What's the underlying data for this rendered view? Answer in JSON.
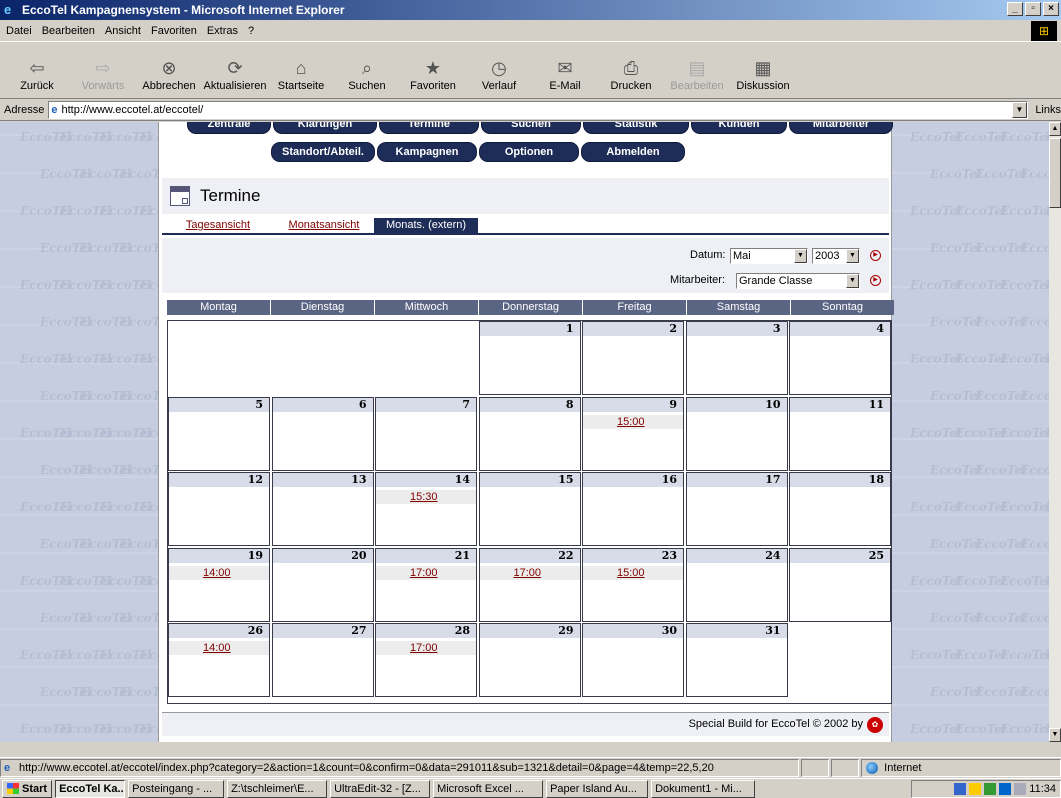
{
  "window": {
    "title": "EccoTel Kampagnensystem - Microsoft Internet Explorer",
    "controls": [
      "_",
      "▫",
      "×"
    ]
  },
  "menu": [
    "Datei",
    "Bearbeiten",
    "Ansicht",
    "Favoriten",
    "Extras",
    "?"
  ],
  "toolbar": [
    {
      "label": "Zurück",
      "icon": "⇦",
      "name": "back-button",
      "disabled": false
    },
    {
      "label": "Vorwärts",
      "icon": "⇨",
      "name": "forward-button",
      "disabled": true
    },
    {
      "label": "Abbrechen",
      "icon": "⊗",
      "name": "stop-button",
      "disabled": false
    },
    {
      "label": "Aktualisieren",
      "icon": "⟳",
      "name": "refresh-button",
      "disabled": false
    },
    {
      "label": "Startseite",
      "icon": "⌂",
      "name": "home-button",
      "disabled": false
    },
    {
      "label": "Suchen",
      "icon": "⌕",
      "name": "search-button",
      "disabled": false
    },
    {
      "label": "Favoriten",
      "icon": "★",
      "name": "favorites-button",
      "disabled": false
    },
    {
      "label": "Verlauf",
      "icon": "◷",
      "name": "history-button",
      "disabled": false
    },
    {
      "label": "E-Mail",
      "icon": "✉",
      "name": "mail-button",
      "disabled": false
    },
    {
      "label": "Drucken",
      "icon": "⎙",
      "name": "print-button",
      "disabled": false
    },
    {
      "label": "Bearbeiten",
      "icon": "▤",
      "name": "edit-button",
      "disabled": true
    },
    {
      "label": "Diskussion",
      "icon": "▦",
      "name": "discuss-button",
      "disabled": false
    }
  ],
  "address": {
    "label": "Adresse",
    "url": "http://www.eccotel.at/eccotel/",
    "links": "Links"
  },
  "nav_row1": [
    "Zentrale",
    "Klärungen",
    "Termine",
    "Suchen",
    "Statistik",
    "Kunden",
    "Mitarbeiter"
  ],
  "nav_row2": [
    "Standort/Abteil.",
    "Kampagnen",
    "Optionen",
    "Abmelden"
  ],
  "page_title": "Termine",
  "tabs": [
    "Tagesansicht",
    "Monatsansicht",
    "Monats. (extern)"
  ],
  "filters": {
    "datum_label": "Datum:",
    "month": "Mai",
    "year": "2003",
    "mitarbeiter_label": "Mitarbeiter:",
    "mitarbeiter": "Grande Classe"
  },
  "weekdays": [
    "Montag",
    "Dienstag",
    "Mittwoch",
    "Donnerstag",
    "Freitag",
    "Samstag",
    "Sonntag"
  ],
  "calendar": {
    "first_weekday_index": 3,
    "days": [
      {
        "day": "1"
      },
      {
        "day": "2"
      },
      {
        "day": "3"
      },
      {
        "day": "4"
      },
      {
        "day": "5"
      },
      {
        "day": "6"
      },
      {
        "day": "7"
      },
      {
        "day": "8"
      },
      {
        "day": "9",
        "appt": "15:00"
      },
      {
        "day": "10"
      },
      {
        "day": "11"
      },
      {
        "day": "12"
      },
      {
        "day": "13"
      },
      {
        "day": "14",
        "appt": "15:30"
      },
      {
        "day": "15"
      },
      {
        "day": "16"
      },
      {
        "day": "17"
      },
      {
        "day": "18"
      },
      {
        "day": "19",
        "appt": "14:00"
      },
      {
        "day": "20"
      },
      {
        "day": "21",
        "appt": "17:00"
      },
      {
        "day": "22",
        "appt": "17:00"
      },
      {
        "day": "23",
        "appt": "15:00"
      },
      {
        "day": "24"
      },
      {
        "day": "25"
      },
      {
        "day": "26",
        "appt": "14:00"
      },
      {
        "day": "27"
      },
      {
        "day": "28",
        "appt": "17:00"
      },
      {
        "day": "29"
      },
      {
        "day": "30"
      },
      {
        "day": "31"
      }
    ]
  },
  "footer": "Special Build for EccoTel © 2002 by",
  "status": {
    "url": "http://www.eccotel.at/eccotel/index.php?category=2&action=1&count=0&confirm=0&data=291011&sub=1321&detail=0&page=4&temp=22,5,20",
    "zone": "Internet"
  },
  "taskbar": {
    "start": "Start",
    "tasks": [
      "EccoTel Ka...",
      "Posteingang - ...",
      "Z:\\tschleimer\\E...",
      "UltraEdit-32 - [Z...",
      "Microsoft Excel ...",
      "Paper Island Au...",
      "Dokument1 - Mi..."
    ],
    "clock": "11:34"
  },
  "watermark": "EccoTel"
}
